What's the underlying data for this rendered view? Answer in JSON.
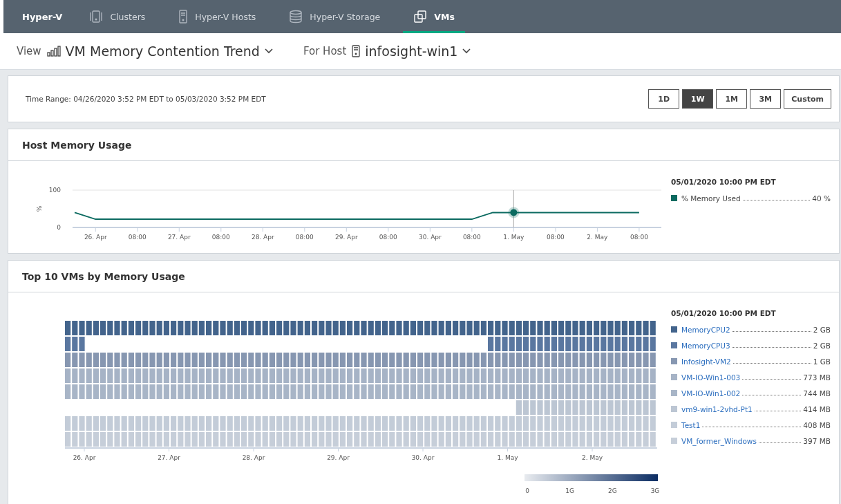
{
  "nav": {
    "brand": "Hyper-V",
    "tabs": [
      {
        "label": "Clusters",
        "kind": "cluster",
        "selected": false
      },
      {
        "label": "Hyper-V Hosts",
        "kind": "server",
        "selected": false
      },
      {
        "label": "Hyper-V Storage",
        "kind": "database",
        "selected": false
      },
      {
        "label": "VMs",
        "kind": "vms",
        "selected": true
      }
    ]
  },
  "toolbar": {
    "view_label": "View",
    "view_value": "VM Memory Contention Trend",
    "host_label": "For Host",
    "host_value": "infosight-win1"
  },
  "time_range": {
    "text": "Time Range: 04/26/2020 3:52 PM EDT to 05/03/2020 3:52 PM EDT",
    "buttons": [
      {
        "label": "1D",
        "selected": false
      },
      {
        "label": "1W",
        "selected": true
      },
      {
        "label": "1M",
        "selected": false
      },
      {
        "label": "3M",
        "selected": false
      },
      {
        "label": "Custom",
        "selected": false
      }
    ]
  },
  "host_memory": {
    "title": "Host Memory Usage",
    "chart_data": {
      "type": "line",
      "ylabel": "%",
      "ylim": [
        0,
        100
      ],
      "yticks": [
        0,
        100
      ],
      "categories": [
        null,
        "26. Apr",
        null,
        "08:00",
        null,
        "27. Apr",
        null,
        "08:00",
        null,
        "28. Apr",
        null,
        "08:00",
        null,
        "29. Apr",
        null,
        "08:00",
        null,
        "30. Apr",
        null,
        "08:00",
        null,
        "1. May",
        null,
        "08:00",
        null,
        "2. May",
        null,
        "08:00"
      ],
      "series": [
        {
          "name": "% Memory Used",
          "color": "#0b6a60",
          "values": [
            40,
            22,
            22,
            22,
            22,
            22,
            22,
            22,
            22,
            22,
            22,
            22,
            22,
            22,
            22,
            22,
            22,
            22,
            22,
            22,
            40,
            40,
            40,
            40,
            40,
            40,
            40,
            40
          ]
        }
      ]
    },
    "legend": {
      "title": "05/01/2020 10:00 PM EDT",
      "value": "40 %"
    }
  },
  "top_vms": {
    "title": "Top 10 VMs by Memory Usage",
    "x_labels": [
      "26. Apr",
      "27. Apr",
      "28. Apr",
      "29. Apr",
      "30. Apr",
      "1. May",
      "2. May"
    ],
    "scale_labels": [
      "0",
      "1G",
      "2G",
      "3G"
    ],
    "legend": {
      "title": "05/01/2020 10:00 PM EDT",
      "items": [
        {
          "name": "MemoryCPU2",
          "value": "2 GB",
          "color": "#43648c"
        },
        {
          "name": "MemoryCPU3",
          "value": "2 GB",
          "color": "#5a77a0"
        },
        {
          "name": "Infosight-VM2",
          "value": "1 GB",
          "color": "#8797b1"
        },
        {
          "name": "VM-IO-Win1-003",
          "value": "773 MB",
          "color": "#a6b3c6"
        },
        {
          "name": "VM-IO-Win1-002",
          "value": "744 MB",
          "color": "#a8b5c7"
        },
        {
          "name": "vm9-win1-2vhd-Pt1",
          "value": "414 MB",
          "color": "#bcc6d3"
        },
        {
          "name": "Test1",
          "value": "408 MB",
          "color": "#c3ccd8"
        },
        {
          "name": "VM_former_Windows",
          "value": "397 MB",
          "color": "#c6ced9"
        }
      ]
    }
  }
}
